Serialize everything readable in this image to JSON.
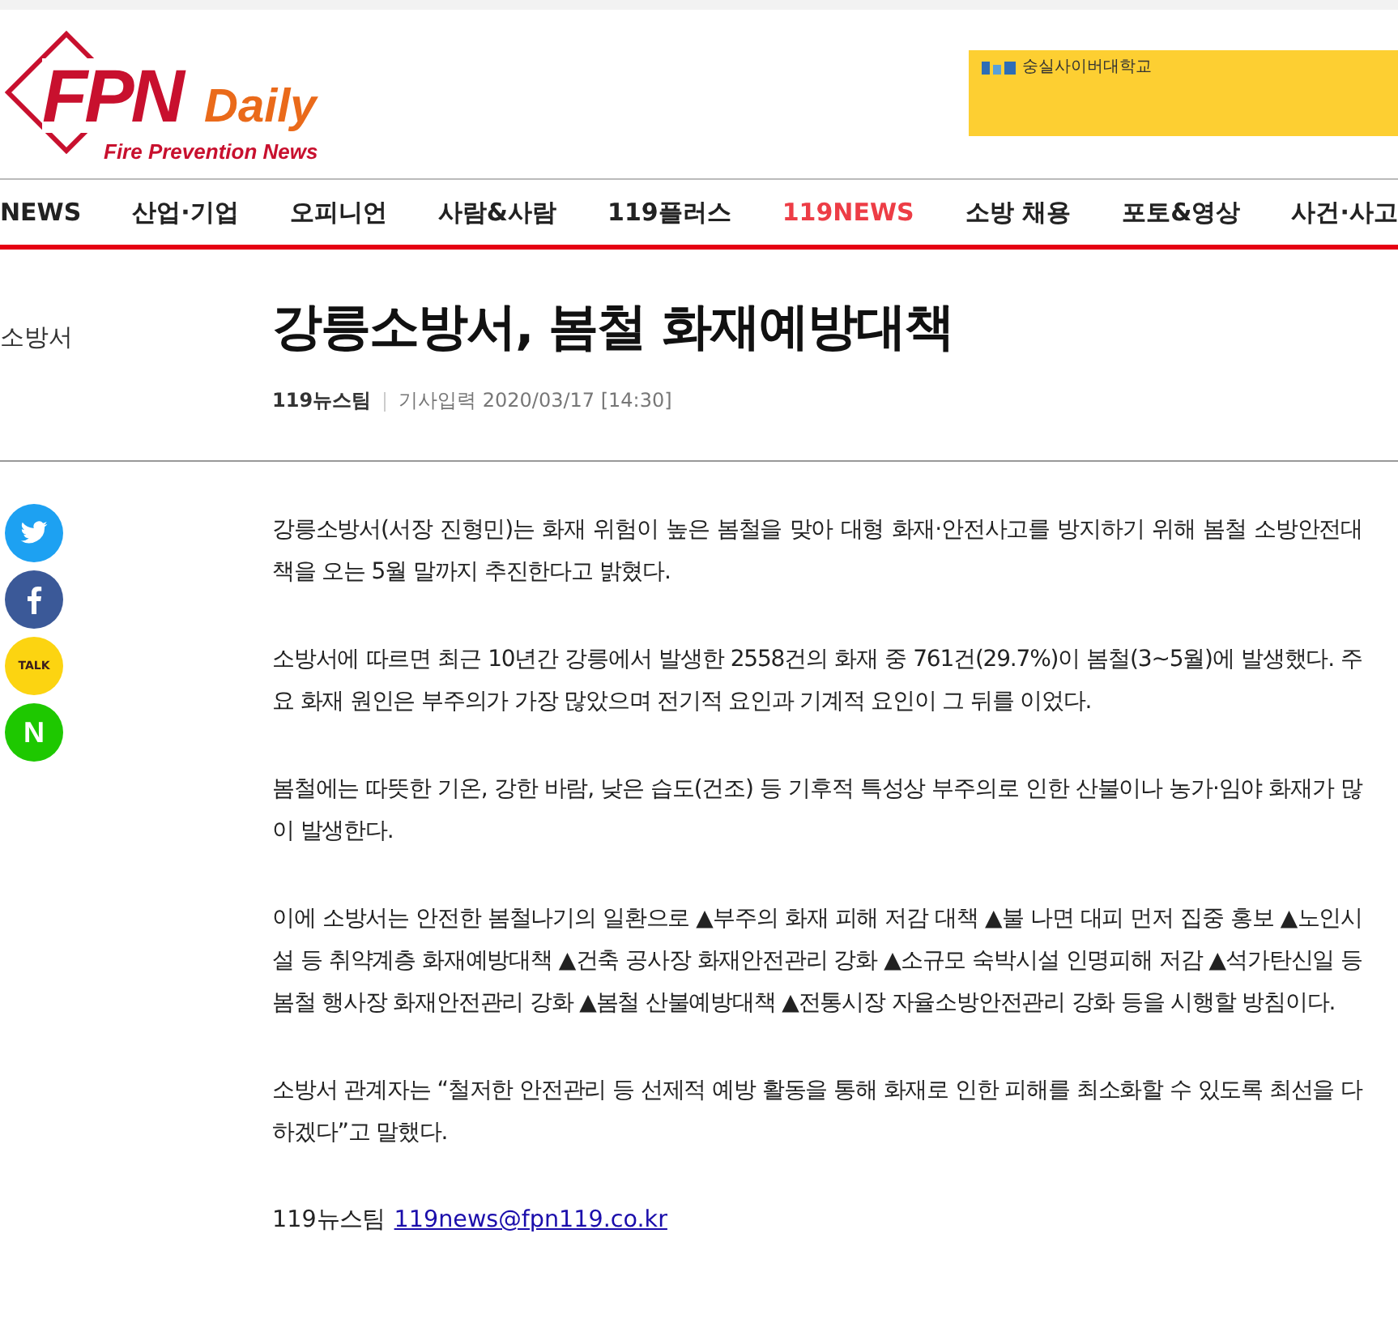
{
  "logo": {
    "brand_main": "FPN",
    "brand_sub": "Daily",
    "tagline": "Fire Prevention News"
  },
  "ad_banner": {
    "text": "숭실사이버대학교"
  },
  "nav": [
    {
      "label": "NEWS",
      "selected": false
    },
    {
      "label": "산업·기업",
      "selected": false
    },
    {
      "label": "오피니언",
      "selected": false
    },
    {
      "label": "사람&사람",
      "selected": false
    },
    {
      "label": "119플러스",
      "selected": false
    },
    {
      "label": "119NEWS",
      "selected": true
    },
    {
      "label": "소방 채용",
      "selected": false
    },
    {
      "label": "포토&영상",
      "selected": false
    },
    {
      "label": "사건·사고",
      "selected": false
    }
  ],
  "section": "소방서",
  "article": {
    "title": "강릉소방서, 봄철 화재예방대책",
    "author": "119뉴스팀",
    "date": "기사입력 2020/03/17 [14:30]",
    "paragraphs": [
      "강릉소방서(서장 진형민)는 화재 위험이 높은 봄철을 맞아 대형 화재·안전사고를 방지하기 위해 봄철 소방안전대책을 오는 5월 말까지 추진한다고 밝혔다.",
      "소방서에 따르면 최근 10년간 강릉에서 발생한 2558건의 화재 중 761건(29.7%)이 봄철(3~5월)에 발생했다. 주요 화재 원인은 부주의가 가장 많았으며 전기적 요인과 기계적 요인이 그 뒤를 이었다.",
      "봄철에는 따뜻한 기온, 강한 바람, 낮은 습도(건조) 등 기후적 특성상 부주의로 인한 산불이나 농가·임야 화재가 많이 발생한다.",
      "이에 소방서는 안전한 봄철나기의 일환으로 ▲부주의 화재 피해 저감 대책 ▲불 나면 대피 먼저 집중 홍보 ▲노인시설 등 취약계층 화재예방대책 ▲건축 공사장 화재안전관리 강화 ▲소규모 숙박시설 인명피해 저감 ▲석가탄신일 등 봄철 행사장 화재안전관리 강화 ▲봄철 산불예방대책 ▲전통시장 자율소방안전관리 강화 등을 시행할 방침이다.",
      "소방서 관계자는 “철저한 안전관리 등 선제적 예방 활동을 통해 화재로 인한 피해를 최소화할 수 있도록 최선을 다하겠다”고 말했다."
    ],
    "byline": {
      "name": "119뉴스팀",
      "email": "119news@fpn119.co.kr"
    }
  },
  "share": [
    {
      "kind": "twitter"
    },
    {
      "kind": "facebook"
    },
    {
      "kind": "kakao",
      "label": "TALK"
    },
    {
      "kind": "naver",
      "label": "N"
    }
  ]
}
